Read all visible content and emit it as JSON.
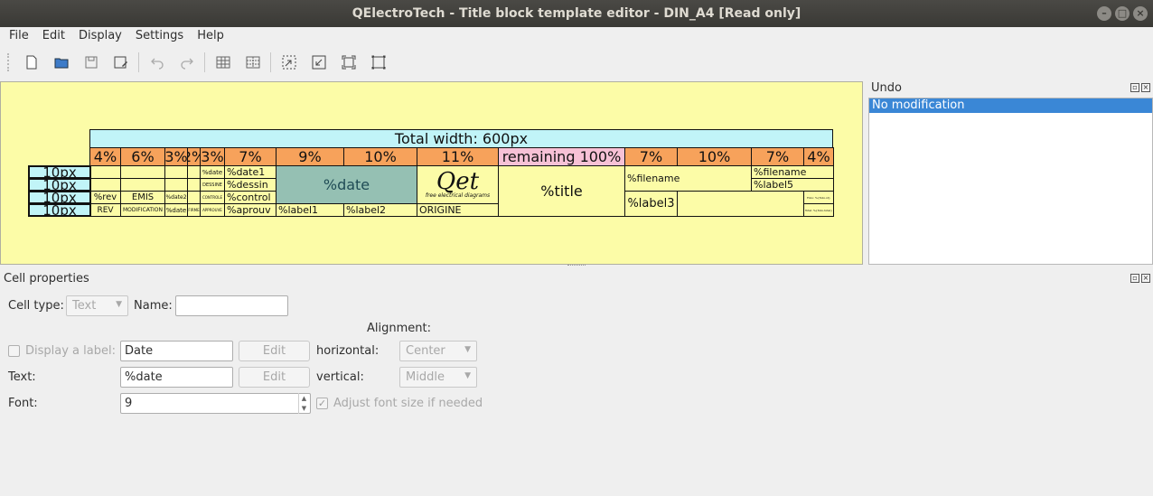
{
  "window": {
    "title": "QElectroTech - Title block template editor - DIN_A4 [Read only]"
  },
  "menu": [
    "File",
    "Edit",
    "Display",
    "Settings",
    "Help"
  ],
  "toolbar": {
    "icons": [
      "new-icon",
      "open-icon",
      "save-icon",
      "save-as-icon",
      "undo-icon",
      "redo-icon",
      "merge-cells-icon",
      "split-cell-icon",
      "zoom-in-icon",
      "zoom-out-icon",
      "zoom-fit-icon",
      "zoom-reset-icon"
    ]
  },
  "template": {
    "total_width_label": "Total width: 600px",
    "col_headers": [
      "4%",
      "6%",
      "3%",
      "2%",
      "3%",
      "7%",
      "9%",
      "10%",
      "11%",
      "remaining 100%",
      "7%",
      "10%",
      "7%",
      "4%"
    ],
    "row_heights": [
      "10px",
      "10px",
      "10px",
      "10px"
    ],
    "cells": {
      "rev_var": "%rev",
      "emis": "EMIS",
      "date2": "%date2",
      "control_lbl": "CONTROLE",
      "rev": "REV",
      "modification": "MODIFICATION",
      "date_small": "%date",
      "firme": "FIRME",
      "approuve": "APPROUVE",
      "date_lbl": "%date",
      "dessin_lbl": "DESSINE",
      "date1": "%date1",
      "dessin": "%dessin",
      "control": "%control",
      "aprouv": "%aprouv",
      "date_big": "%date",
      "label1": "%label1",
      "label2": "%label2",
      "origine": "ORIGINE",
      "logo_text": "Qet",
      "logo_sub": "free electrical diagrams",
      "title": "%title",
      "filename": "%filename",
      "label3": "%label3",
      "filename2": "%filename",
      "label5": "%label5",
      "folio_a": "Folio: %{folio-id}",
      "folio_b": "Total: %{folio-total}"
    }
  },
  "undo_panel": {
    "title": "Undo",
    "items": [
      "No modification"
    ]
  },
  "cell_properties": {
    "title": "Cell properties",
    "cell_type_label": "Cell type:",
    "cell_type_value": "Text",
    "name_label": "Name:",
    "name_value": "",
    "alignment_label": "Alignment:",
    "display_label_text": "Display a label:",
    "label_value": "Date",
    "edit1": "Edit",
    "horizontal_label": "horizontal:",
    "horizontal_value": "Center",
    "text_label": "Text:",
    "text_value": "%date",
    "edit2": "Edit",
    "vertical_label": "vertical:",
    "vertical_value": "Middle",
    "font_label": "Font:",
    "font_value": "9",
    "adjust_label": "Adjust font size if needed"
  },
  "colors": {
    "canvas_bg": "#fcfca7",
    "total_width_bg": "#c1f4f8",
    "col_header_bg": "#f7a25b",
    "remaining_bg": "#f7c1d6",
    "merged_cell_bg": "#95c0b3",
    "selection": "#3a87d6"
  }
}
